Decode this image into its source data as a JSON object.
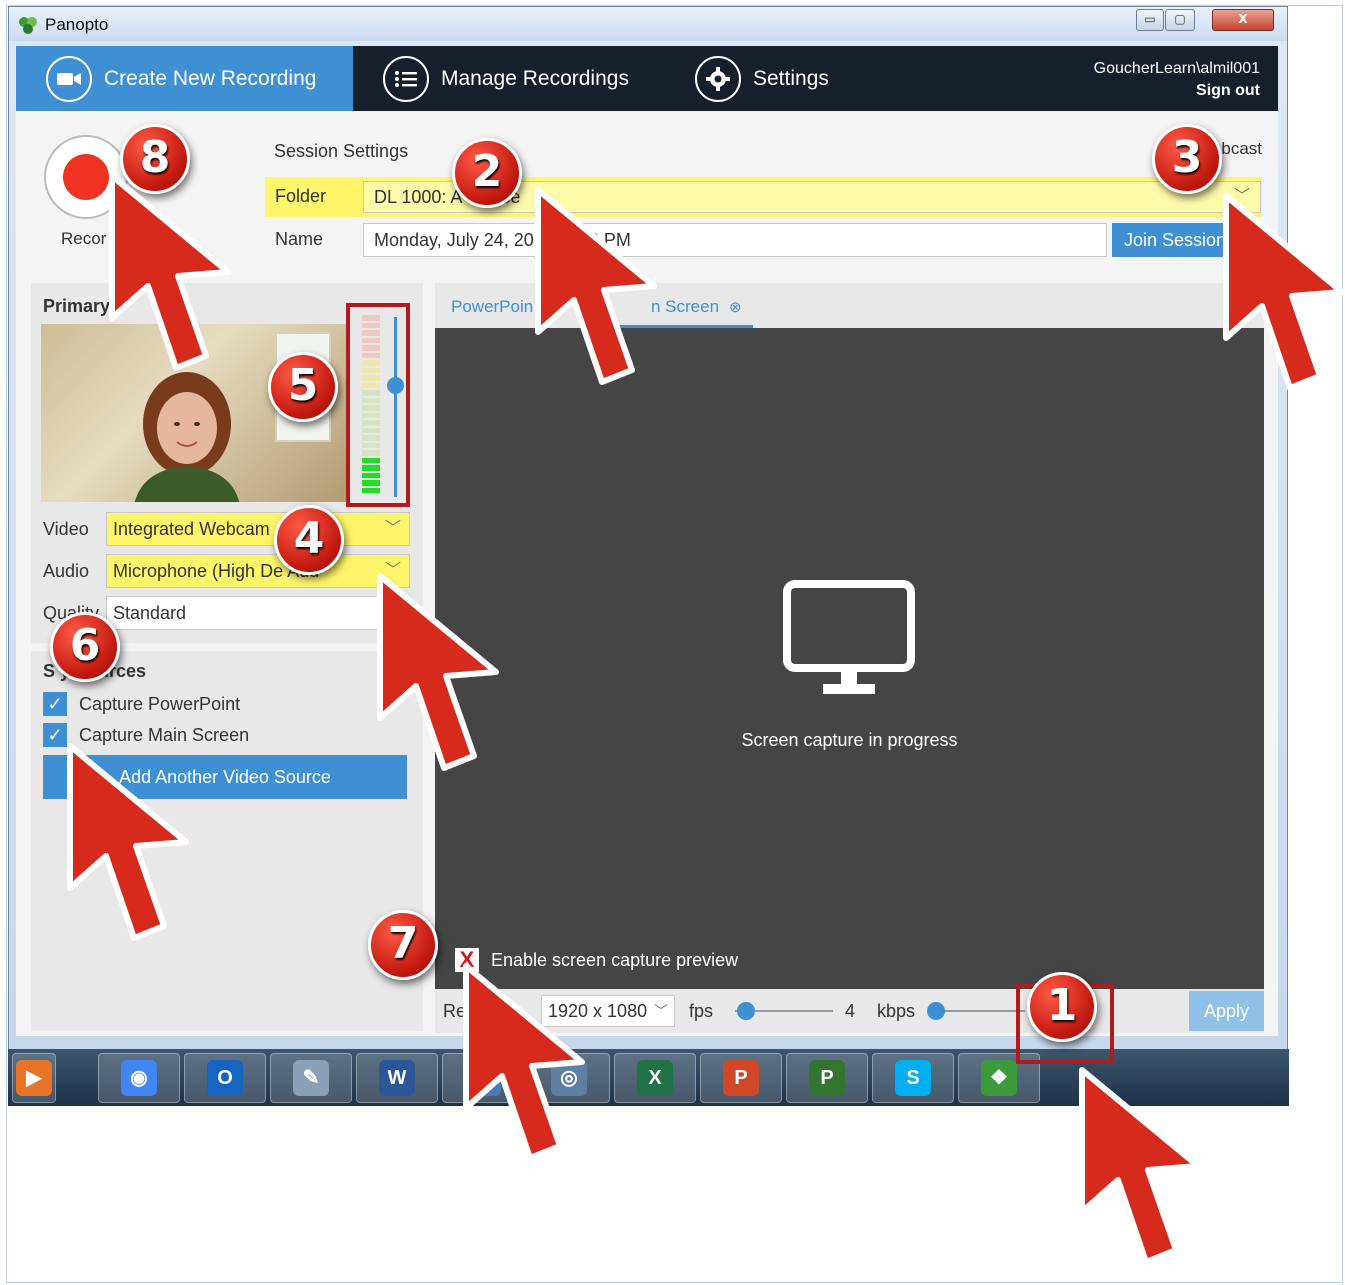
{
  "window": {
    "title": "Panopto",
    "min_glyph": "▭",
    "max_glyph": "▢",
    "close_glyph": "X"
  },
  "nav": {
    "tabs": [
      {
        "label": "Create New Recording",
        "icon": "camera-icon",
        "active": true
      },
      {
        "label": "Manage Recordings",
        "icon": "list-icon",
        "active": false
      },
      {
        "label": "Settings",
        "icon": "gear-icon",
        "active": false
      }
    ],
    "user": "GoucherLearn\\almil001",
    "sign_out": "Sign out"
  },
  "record": {
    "label": "Recor"
  },
  "session": {
    "title": "Session Settings",
    "webcast_label": "bcast",
    "folder_label": "Folder",
    "folder_value": "DL 1000: A          course",
    "name_label": "Name",
    "name_value": "Monday, July 24, 201      :23:28 PM",
    "join_button": "Join Session"
  },
  "primary": {
    "title": "Primary",
    "video_label": "Video",
    "video_value": "Integrated Webcam",
    "audio_label": "Audio",
    "audio_value": "Microphone (High De           Aud",
    "quality_label": "Quality",
    "quality_value": "Standard",
    "audio_level": 0.2,
    "volume_level": 0.62
  },
  "secondary": {
    "title": "S        y Sources",
    "sources": [
      {
        "label": "Capture PowerPoint",
        "checked": true
      },
      {
        "label": "Capture Main Screen",
        "checked": true
      }
    ],
    "add_button": "Add Another Video Source"
  },
  "preview": {
    "tab_powerpoint": "PowerPoin",
    "tab_mainscreen": "n Screen",
    "tab_close": "⊗",
    "capture_text": "Screen capture in progress",
    "enable_preview_label": "Enable screen capture preview",
    "enable_preview_checked": false
  },
  "capture_settings": {
    "resolution_label": "Res        on",
    "resolution_value": "1920 x 1080",
    "fps_label": "fps",
    "fps_value": "4",
    "kbps_label": "kbps",
    "apply_button": "Apply"
  },
  "taskbar": {
    "items": [
      {
        "name": "media-player-icon",
        "glyph": "▶",
        "color": "#e8742a"
      },
      {
        "name": "chrome-icon",
        "glyph": "◉",
        "color": "#4285f4"
      },
      {
        "name": "outlook-icon",
        "glyph": "O",
        "color": "#1565c0"
      },
      {
        "name": "notes-icon",
        "glyph": "✎",
        "color": "#8aa0b5"
      },
      {
        "name": "word-icon",
        "glyph": "W",
        "color": "#2b579a"
      },
      {
        "name": "lync-icon",
        "glyph": "L",
        "color": "#4b7bb7"
      },
      {
        "name": "media-icon",
        "glyph": "◎",
        "color": "#5c7fa3"
      },
      {
        "name": "excel-icon",
        "glyph": "X",
        "color": "#217346"
      },
      {
        "name": "powerpoint-icon",
        "glyph": "P",
        "color": "#d24726"
      },
      {
        "name": "project-icon",
        "glyph": "P",
        "color": "#31752f"
      },
      {
        "name": "skype-icon",
        "glyph": "S",
        "color": "#00aff0"
      },
      {
        "name": "panopto-icon",
        "glyph": "❖",
        "color": "#3c9a3c"
      }
    ]
  },
  "annotations": {
    "badges": [
      "8",
      "2",
      "3",
      "5",
      "4",
      "6",
      "7",
      "1"
    ],
    "badge_color": "#d7261a"
  }
}
